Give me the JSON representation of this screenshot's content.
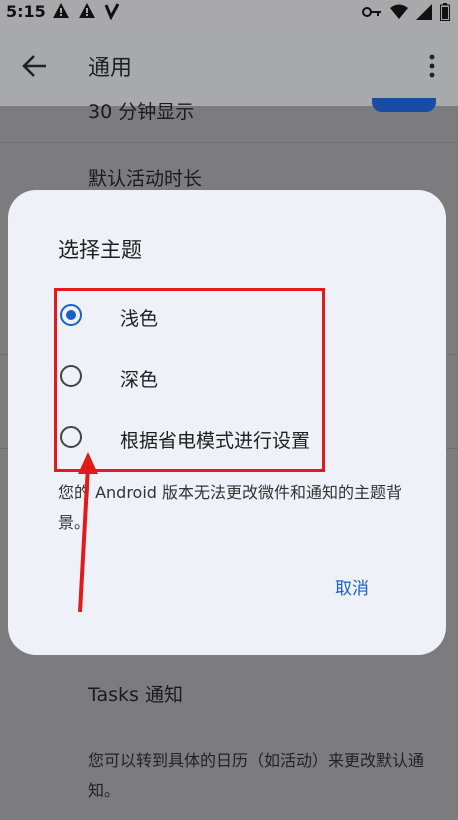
{
  "status_bar": {
    "time": "5:15",
    "left_icons": [
      "warning-icon",
      "warning-icon",
      "signal-v-icon"
    ],
    "right_icons": [
      "key-icon",
      "wifi-icon",
      "signal-icon",
      "battery-icon"
    ]
  },
  "appbar": {
    "title": "通用"
  },
  "background": {
    "row1_label": "30 分钟显示",
    "row2_label": "默认活动时长",
    "tasks_label": "Tasks 通知",
    "tasks_desc": "您可以转到具体的日历（如活动）来更改默认通知。"
  },
  "dialog": {
    "title": "选择主题",
    "options": [
      {
        "label": "浅色",
        "selected": true
      },
      {
        "label": "深色",
        "selected": false
      },
      {
        "label": "根据省电模式进行设置",
        "selected": false
      }
    ],
    "note": "您的 Android 版本无法更改微件和通知的主题背景。",
    "cancel_label": "取消"
  },
  "colors": {
    "accent": "#1a5fc8",
    "annotation_red": "#e21a1a",
    "dialog_bg": "#eef1f8"
  }
}
